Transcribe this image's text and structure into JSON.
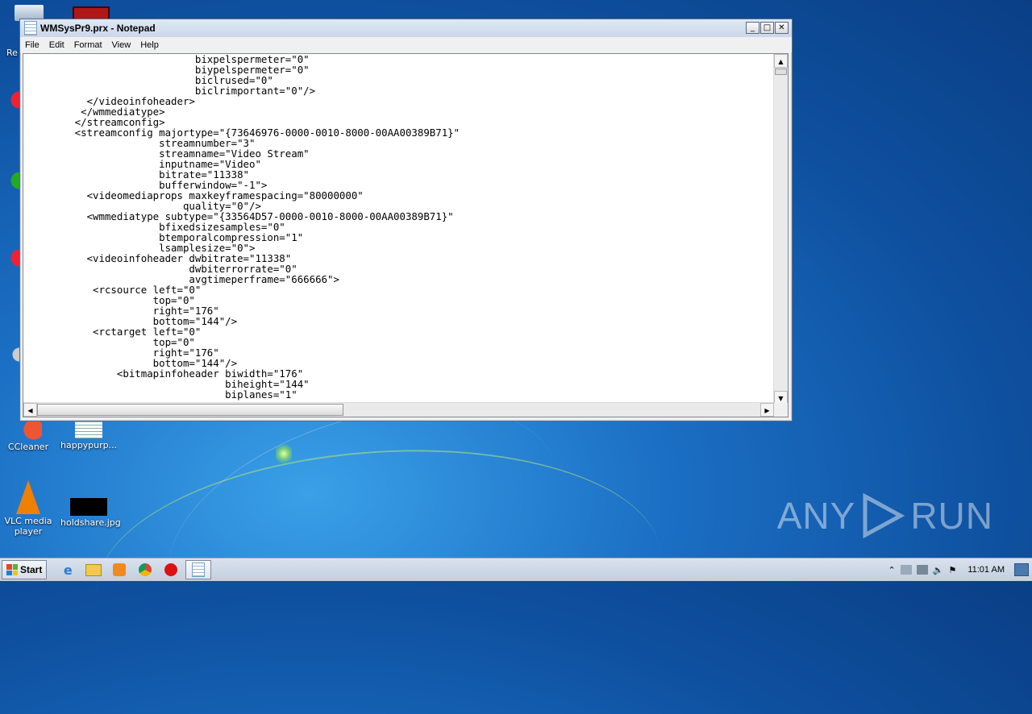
{
  "window": {
    "title": "WMSysPr9.prx - Notepad",
    "min_glyph": "_",
    "max_glyph": "□",
    "close_glyph": "✕",
    "menu": [
      "File",
      "Edit",
      "Format",
      "View",
      "Help"
    ]
  },
  "editor_lines": [
    "                            bixpelspermeter=\"0\"",
    "                            biypelspermeter=\"0\"",
    "                            biclrused=\"0\"",
    "                            biclrimportant=\"0\"/>",
    "          </videoinfoheader>",
    "         </wmmediatype>",
    "        </streamconfig>",
    "        <streamconfig majortype=\"{73646976-0000-0010-8000-00AA00389B71}\"",
    "                      streamnumber=\"3\"",
    "                      streamname=\"Video Stream\"",
    "                      inputname=\"Video\"",
    "                      bitrate=\"11338\"",
    "                      bufferwindow=\"-1\">",
    "          <videomediaprops maxkeyframespacing=\"80000000\"",
    "                          quality=\"0\"/>",
    "          <wmmediatype subtype=\"{33564D57-0000-0010-8000-00AA00389B71}\"",
    "                      bfixedsizesamples=\"0\"",
    "                      btemporalcompression=\"1\"",
    "                      lsamplesize=\"0\">",
    "          <videoinfoheader dwbitrate=\"11338\"",
    "                           dwbiterrorrate=\"0\"",
    "                           avgtimeperframe=\"666666\">",
    "           <rcsource left=\"0\"",
    "                     top=\"0\"",
    "                     right=\"176\"",
    "                     bottom=\"144\"/>",
    "           <rctarget left=\"0\"",
    "                     top=\"0\"",
    "                     right=\"176\"",
    "                     bottom=\"144\"/>",
    "               <bitmapinfoheader biwidth=\"176\"",
    "                                 biheight=\"144\"",
    "                                 biplanes=\"1\""
  ],
  "desktop_icons": {
    "ccleaner": "CCleaner",
    "happypurp": "happypurp...",
    "vlc": "VLC media player",
    "holdshare": "holdshare.jpg",
    "recycle_partial": "Re"
  },
  "watermark": {
    "left": "ANY",
    "right": "RUN"
  },
  "taskbar": {
    "start_label": "Start",
    "clock": "11:01 AM",
    "tray_up": "⌃"
  }
}
